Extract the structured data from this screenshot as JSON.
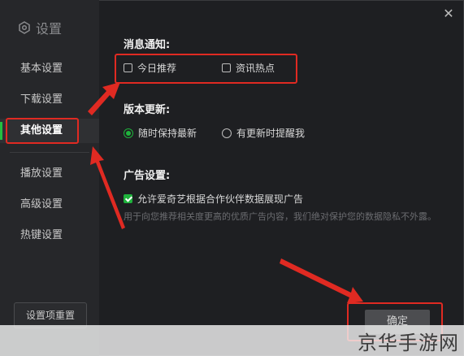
{
  "window": {
    "title": "设置",
    "close_label": "✕"
  },
  "sidebar": {
    "items": [
      {
        "label": "基本设置"
      },
      {
        "label": "下载设置"
      },
      {
        "label": "其他设置"
      },
      {
        "label": "播放设置"
      },
      {
        "label": "高级设置"
      },
      {
        "label": "热键设置"
      }
    ],
    "reset_label": "设置项重置"
  },
  "notify": {
    "title": "消息通知:",
    "today_label": "今日推荐",
    "news_label": "资讯热点"
  },
  "update": {
    "title": "版本更新:",
    "latest_label": "随时保持最新",
    "remind_label": "有更新时提醒我"
  },
  "ads": {
    "title": "广告设置:",
    "allow_label": "允许爱奇艺根据合作伙伴数据展现广告",
    "note": "用于向您推荐相关度更高的优质广告内容，我们绝对保护您的数据隐私不外露。"
  },
  "footer": {
    "ok_label": "确定"
  },
  "watermark": {
    "text": "京华手游网"
  },
  "colors": {
    "accent": "#23c040",
    "highlight": "#e02a22"
  }
}
